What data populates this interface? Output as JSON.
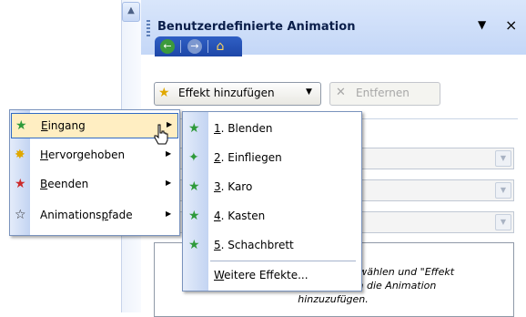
{
  "pane": {
    "title": "Benutzerdefinierte Animation",
    "menu_glyph": "▼",
    "close_glyph": "×"
  },
  "nav": {
    "back": "←",
    "forward": "→",
    "home": "⌂"
  },
  "toolbar": {
    "add_effect_label": "Effekt hinzufügen",
    "add_effect_arrow": "▼",
    "remove_label": "Entfernen"
  },
  "hint_text_lines": [
    "Ein Element auf der Folie auswählen und \"Effekt",
    "hinzufügen\" anklicken, um die Animation",
    "hinzuzufügen."
  ],
  "menu": {
    "items": [
      {
        "mnemonic": "E",
        "rest": "ingang",
        "icon": "entrance-star-icon",
        "color": "#2e9a3a",
        "selected": true
      },
      {
        "mnemonic": "H",
        "rest": "ervorgehoben",
        "icon": "emphasis-star-icon",
        "color": "#e0a800",
        "selected": false
      },
      {
        "mnemonic": "B",
        "rest": "eenden",
        "icon": "exit-star-icon",
        "color": "#cc2a2a",
        "selected": false
      },
      {
        "pre": "Animations",
        "mnemonic": "p",
        "rest": "fade",
        "icon": "motion-path-star-icon",
        "color": "#2a2a2a",
        "selected": false
      }
    ]
  },
  "submenu": {
    "items": [
      {
        "num": "1",
        "label": "Blenden"
      },
      {
        "num": "2",
        "label": "Einfliegen"
      },
      {
        "num": "3",
        "label": "Karo"
      },
      {
        "num": "4",
        "label": "Kasten"
      },
      {
        "num": "5",
        "label": "Schachbrett"
      }
    ],
    "more_mnemonic": "W",
    "more_rest": "eitere Effekte..."
  },
  "colors": {
    "selection_bg": "#ffeec2",
    "selection_border": "#316ac5",
    "header_blue": "#c4d7f7",
    "nav_blue": "#1e47a8"
  }
}
